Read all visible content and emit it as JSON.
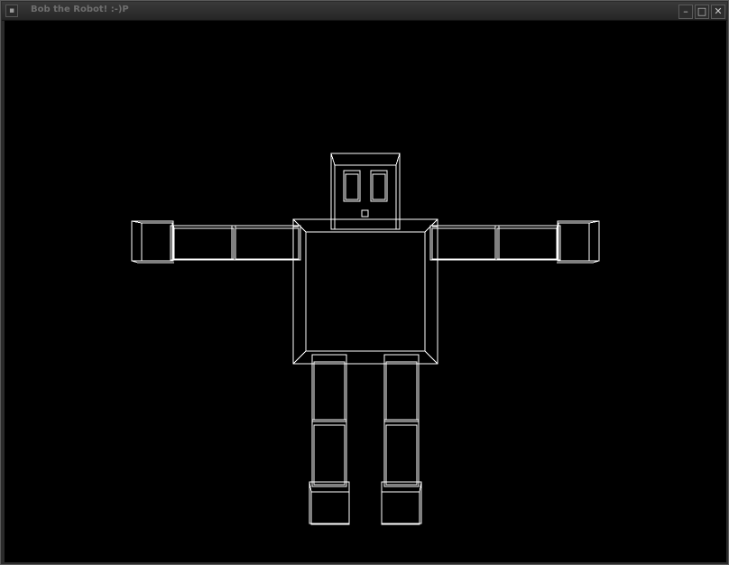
{
  "window": {
    "title": "Bob the Robot! :-)P",
    "controls": {
      "menu_glyph": "▪",
      "minimize_glyph": "–",
      "maximize_glyph": "□",
      "close_glyph": "✕"
    }
  },
  "scene": {
    "background": "#000000",
    "line_color": "#ffffff",
    "render_mode": "wireframe"
  }
}
